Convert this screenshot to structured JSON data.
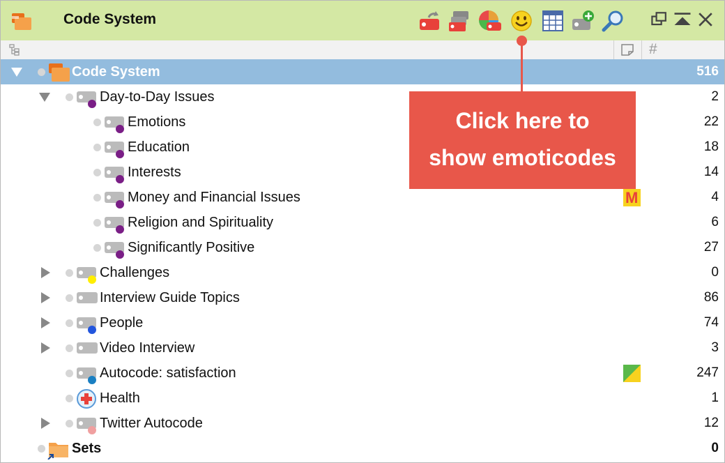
{
  "window": {
    "title": "Code System"
  },
  "toolbar": {
    "buttons": [
      {
        "name": "reset-tag-icon"
      },
      {
        "name": "code-frequency-icon"
      },
      {
        "name": "code-colors-icon"
      },
      {
        "name": "emoticode-icon"
      },
      {
        "name": "table-icon"
      },
      {
        "name": "new-code-icon"
      },
      {
        "name": "search-icon"
      }
    ],
    "window_controls": [
      "undock-icon",
      "collapse-icon",
      "close-icon"
    ]
  },
  "columns": {
    "memo": "memo-column-icon",
    "count": "#"
  },
  "colors": {
    "purple": "#7a1e86",
    "yellow": "#ffee00",
    "blue": "#2255dd",
    "teal": "#1a7fc2",
    "pink": "#f0a0a0",
    "selected": "#93bcde",
    "accent": "#e8574a"
  },
  "tree": {
    "root": {
      "label": "Code System",
      "count": "516"
    },
    "rows": [
      {
        "label": "Day-to-Day Issues",
        "count": "2",
        "level": 1,
        "expanded": true,
        "color": "#7a1e86"
      },
      {
        "label": "Emotions",
        "count": "22",
        "level": 2,
        "color": "#7a1e86"
      },
      {
        "label": "Education",
        "count": "18",
        "level": 2,
        "color": "#7a1e86"
      },
      {
        "label": "Interests",
        "count": "14",
        "level": 2,
        "color": "#7a1e86"
      },
      {
        "label": "Money and Financial Issues",
        "count": "4",
        "level": 2,
        "color": "#7a1e86"
      },
      {
        "label": "Religion and Spirituality",
        "count": "6",
        "level": 2,
        "color": "#7a1e86"
      },
      {
        "label": "Significantly Positive",
        "count": "27",
        "level": 2,
        "color": "#7a1e86"
      },
      {
        "label": "Challenges",
        "count": "0",
        "level": 1,
        "collapsed": true,
        "color": "#ffee00"
      },
      {
        "label": "Interview Guide Topics",
        "count": "86",
        "level": 1,
        "collapsed": true
      },
      {
        "label": "People",
        "count": "74",
        "level": 1,
        "collapsed": true,
        "color": "#2255dd"
      },
      {
        "label": "Video Interview",
        "count": "3",
        "level": 1,
        "collapsed": true
      },
      {
        "label": "Autocode: satisfaction",
        "count": "247",
        "level": 1,
        "color": "#1a7fc2"
      },
      {
        "label": "Health",
        "count": "1",
        "level": 1
      },
      {
        "label": "Twitter Autocode",
        "count": "12",
        "level": 1,
        "collapsed": true,
        "color": "#f0a0a0"
      }
    ],
    "sets": {
      "label": "Sets",
      "count": "0"
    }
  },
  "memos": {
    "money": "M"
  },
  "callout": {
    "line1": "Click here to",
    "line2": "show emoticodes"
  }
}
